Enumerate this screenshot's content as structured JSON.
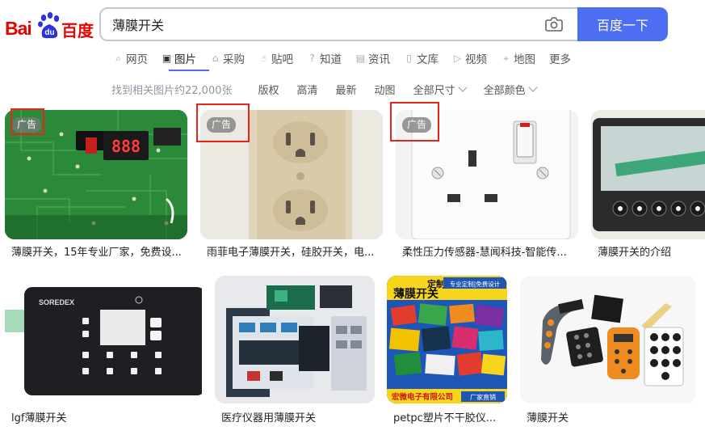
{
  "logo": {
    "text_latin": "Bai",
    "paw_text": "du",
    "text_cn": "百度"
  },
  "search": {
    "query": "薄膜开关",
    "button_label": "百度一下"
  },
  "tabs": [
    {
      "label": "网页",
      "icon": "search-icon"
    },
    {
      "label": "图片",
      "icon": "image-icon"
    },
    {
      "label": "采购",
      "icon": "basket-icon"
    },
    {
      "label": "贴吧",
      "icon": "thumb-icon"
    },
    {
      "label": "知道",
      "icon": "question-icon"
    },
    {
      "label": "资讯",
      "icon": "news-icon"
    },
    {
      "label": "文库",
      "icon": "doc-icon"
    },
    {
      "label": "视频",
      "icon": "play-icon"
    },
    {
      "label": "地图",
      "icon": "map-pin-icon"
    },
    {
      "label": "更多",
      "icon": ""
    }
  ],
  "active_tab": "图片",
  "filters": {
    "count": "找到相关图片约22,000张",
    "items": [
      "版权",
      "高清",
      "最新",
      "动图"
    ],
    "dropdowns": [
      "全部尺寸",
      "全部颜色"
    ]
  },
  "results": [
    {
      "caption": "薄膜开关，15年专业厂家，免费设...",
      "ad": "广告"
    },
    {
      "caption": "雨菲电子薄膜开关，硅胶开关，电...",
      "ad": "广告"
    },
    {
      "caption": "柔性压力传感器-慧闻科技-智能传...",
      "ad": "广告"
    },
    {
      "caption": "薄膜开关的介绍",
      "ad": ""
    },
    {
      "caption": "lgf薄膜开关",
      "ad": ""
    },
    {
      "caption": "医疗仪器用薄膜开关",
      "ad": ""
    },
    {
      "caption": "petpc塑片不干胶仪...",
      "ad": ""
    },
    {
      "caption": "薄膜开关",
      "ad": ""
    }
  ],
  "image_text": {
    "pcb_display": "888",
    "soredex_brand": "SOREDEX",
    "poster_title": "薄膜开关",
    "poster_tag": "定制",
    "poster_banner": "专业定制|免费设计",
    "poster_company": "宏微电子有限公司",
    "poster_direct": "厂家直销"
  },
  "colors": {
    "accent": "#4e6ef2",
    "brand_red": "#e10601",
    "ad_frame": "#e8231a"
  }
}
